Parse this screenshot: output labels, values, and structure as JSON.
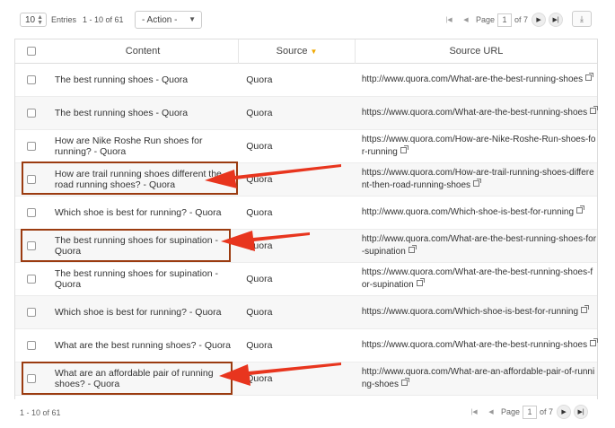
{
  "toolbar": {
    "entries_value": "10",
    "entries_label": "Entries",
    "range_label": "1 - 10 of 61",
    "action_label": "- Action -"
  },
  "pager": {
    "page_label": "Page",
    "page_value": "1",
    "of_label": "of 7"
  },
  "table": {
    "headers": {
      "content": "Content",
      "source": "Source",
      "source_url": "Source URL"
    },
    "rows": [
      {
        "content": "The best running shoes - Quora",
        "source": "Quora",
        "url": "http://www.quora.com/What-are-the-best-running-shoes"
      },
      {
        "content": "The best running shoes - Quora",
        "source": "Quora",
        "url": "https://www.quora.com/What-are-the-best-running-shoes"
      },
      {
        "content": "How are Nike Roshe Run shoes for running? - Quora",
        "source": "Quora",
        "url": "https://www.quora.com/How-are-Nike-Roshe-Run-shoes-for-running"
      },
      {
        "content": "How are trail running shoes different the road running shoes? - Quora",
        "source": "Quora",
        "url": "https://www.quora.com/How-are-trail-running-shoes-different-then-road-running-shoes"
      },
      {
        "content": "Which shoe is best for running? - Quora",
        "source": "Quora",
        "url": "http://www.quora.com/Which-shoe-is-best-for-running"
      },
      {
        "content": "The best running shoes for supination - Quora",
        "source": "Quora",
        "url": "http://www.quora.com/What-are-the-best-running-shoes-for-supination"
      },
      {
        "content": "The best running shoes for supination - Quora",
        "source": "Quora",
        "url": "https://www.quora.com/What-are-the-best-running-shoes-for-supination"
      },
      {
        "content": "Which shoe is best for running? - Quora",
        "source": "Quora",
        "url": "https://www.quora.com/Which-shoe-is-best-for-running"
      },
      {
        "content": "What are the best running shoes? - Quora",
        "source": "Quora",
        "url": "https://www.quora.com/What-are-the-best-running-shoes"
      },
      {
        "content": "What are an affordable pair of running shoes? - Quora",
        "source": "Quora",
        "url": "http://www.quora.com/What-are-an-affordable-pair-of-running-shoes"
      }
    ]
  },
  "footer": {
    "range_label": "1 - 10 of 61"
  },
  "icons": {
    "first": "first-page-icon",
    "prev": "prev-page-icon",
    "next": "next-page-icon",
    "last": "last-page-icon",
    "download": "download-icon",
    "external": "external-link-icon",
    "sort": "sort-desc-icon"
  },
  "colors": {
    "highlight_box": "#9b3b10",
    "arrow": "#e8351e",
    "sort_caret": "#f0a800"
  }
}
